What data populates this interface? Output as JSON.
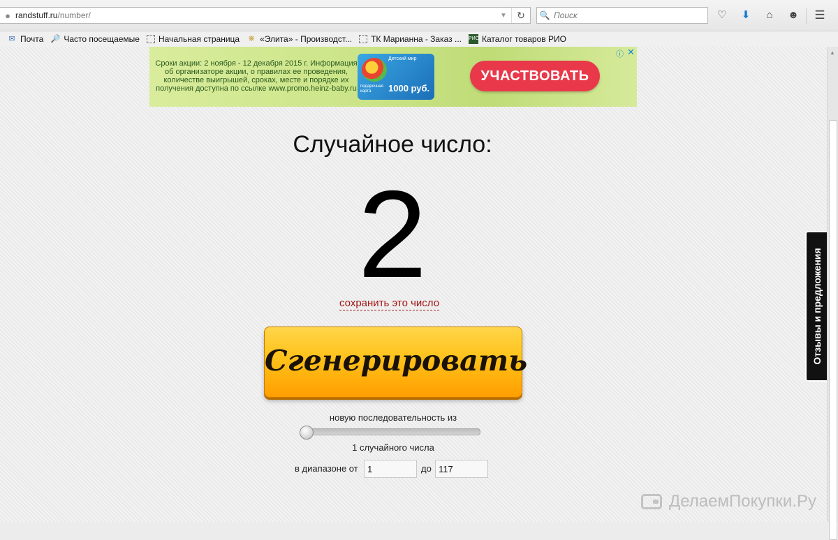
{
  "browser": {
    "url_host": "randstuff.ru",
    "url_path": "/number/",
    "search_placeholder": "Поиск"
  },
  "bookmarks": [
    {
      "label": "Почта",
      "icon": "mail-icon"
    },
    {
      "label": "Часто посещаемые",
      "icon": "folder-icon"
    },
    {
      "label": "Начальная страница",
      "icon": "search-icon"
    },
    {
      "label": "«Элита» - Производст...",
      "icon": "folder-icon"
    },
    {
      "label": "ТК Марианна - Заказ ...",
      "icon": "gold-icon"
    },
    {
      "label": "Каталог товаров РИО",
      "icon": "folder-icon"
    }
  ],
  "ad": {
    "text": "Сроки акции: 2 ноября - 12 декабря 2015 г. Информация об организаторе акции, о правилах ее проведения, количестве выигрышей, сроках, месте и порядке их получения доступна по ссылке www.promo.heinz-baby.ru",
    "card_brand": "Детский мир",
    "card_gift": "подарочная карта",
    "card_amount": "1000 руб.",
    "cta": "УЧАСТВОВАТЬ"
  },
  "main": {
    "title": "Случайное число:",
    "number": "2",
    "save_link": "сохранить это число",
    "generate_button": "Сгенерировать",
    "sequence_label": "новую последовательность из",
    "count_label": "1 случайного числа",
    "slider_level": 0,
    "range_label": "в диапазоне от",
    "range_from": "1",
    "range_to_label": "до",
    "range_to": "117"
  },
  "feedback_tab": "Отзывы и предложения",
  "watermark": "ДелаемПокупки.Ру",
  "colors": {
    "button_top": "#ffd54a",
    "button_bottom": "#ff9e00",
    "save_link": "#a31717",
    "ad_cta": "#e8384a"
  }
}
